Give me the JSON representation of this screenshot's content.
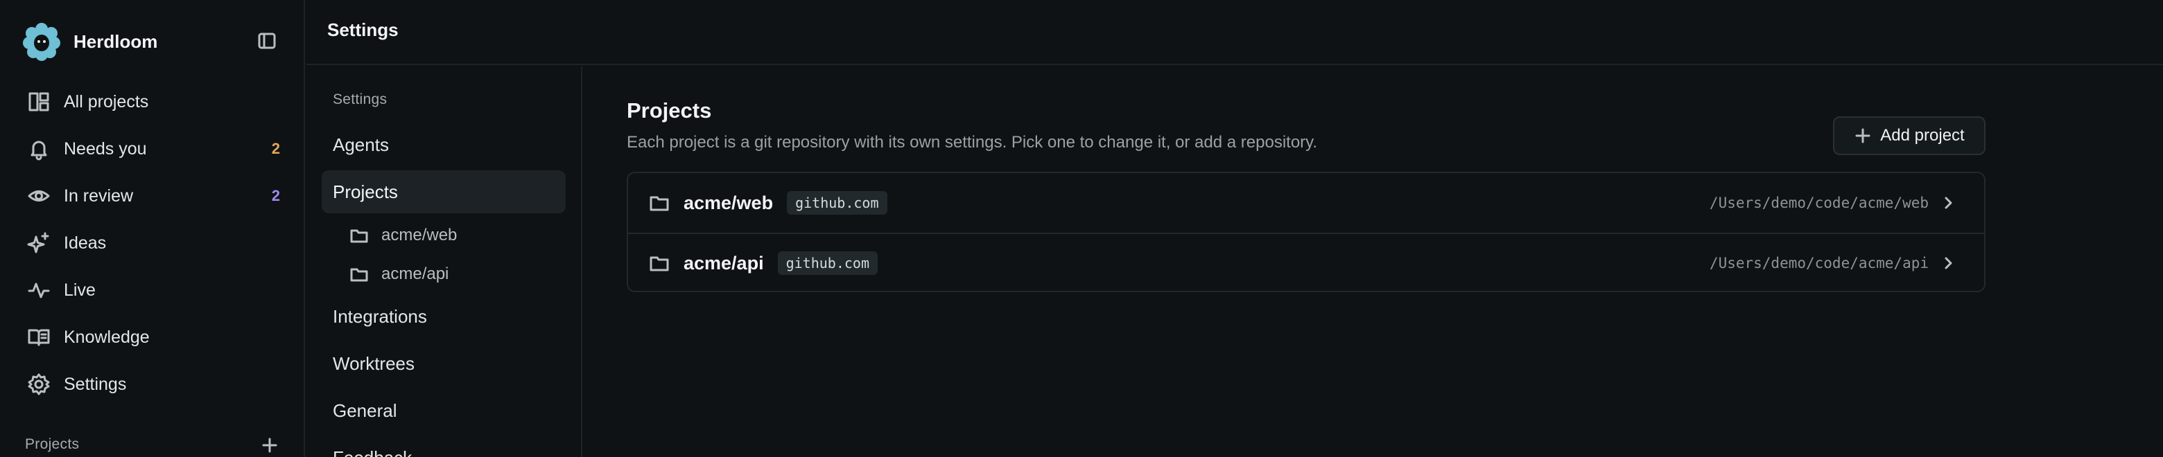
{
  "app": {
    "name": "Herdloom"
  },
  "sidebar": {
    "items": [
      {
        "label": "All projects",
        "icon": "grid-icon"
      },
      {
        "label": "Needs you",
        "icon": "bell-icon",
        "count": "2",
        "count_color": "#e3a75a"
      },
      {
        "label": "In review",
        "icon": "eye-icon",
        "count": "2",
        "count_color": "#9b8cf0"
      },
      {
        "label": "Ideas",
        "icon": "sparkles-icon"
      },
      {
        "label": "Live",
        "icon": "activity-icon"
      },
      {
        "label": "Knowledge",
        "icon": "book-icon"
      },
      {
        "label": "Settings",
        "icon": "gear-icon"
      }
    ],
    "projects_label": "Projects"
  },
  "topbar": {
    "title": "Settings"
  },
  "settings_nav": {
    "heading": "Settings",
    "items": [
      {
        "label": "Agents"
      },
      {
        "label": "Projects",
        "active": true
      },
      {
        "label": "Integrations"
      },
      {
        "label": "Worktrees"
      },
      {
        "label": "General"
      },
      {
        "label": "Feedback"
      }
    ],
    "project_children": [
      "acme/web",
      "acme/api"
    ]
  },
  "main": {
    "title": "Projects",
    "description": "Each project is a git repository with its own settings. Pick one to change it, or add a repository.",
    "add_button_label": "Add project",
    "projects": [
      {
        "name": "acme/web",
        "host": "github.com",
        "path": "/Users/demo/code/acme/web"
      },
      {
        "name": "acme/api",
        "host": "github.com",
        "path": "/Users/demo/code/acme/api"
      }
    ]
  },
  "colors": {
    "background": "#0f1214",
    "active_nav": "#1c2225",
    "logo": "#6fbfd6",
    "needs_you_count": "#e3a75a",
    "in_review_count": "#9b8cf0"
  }
}
